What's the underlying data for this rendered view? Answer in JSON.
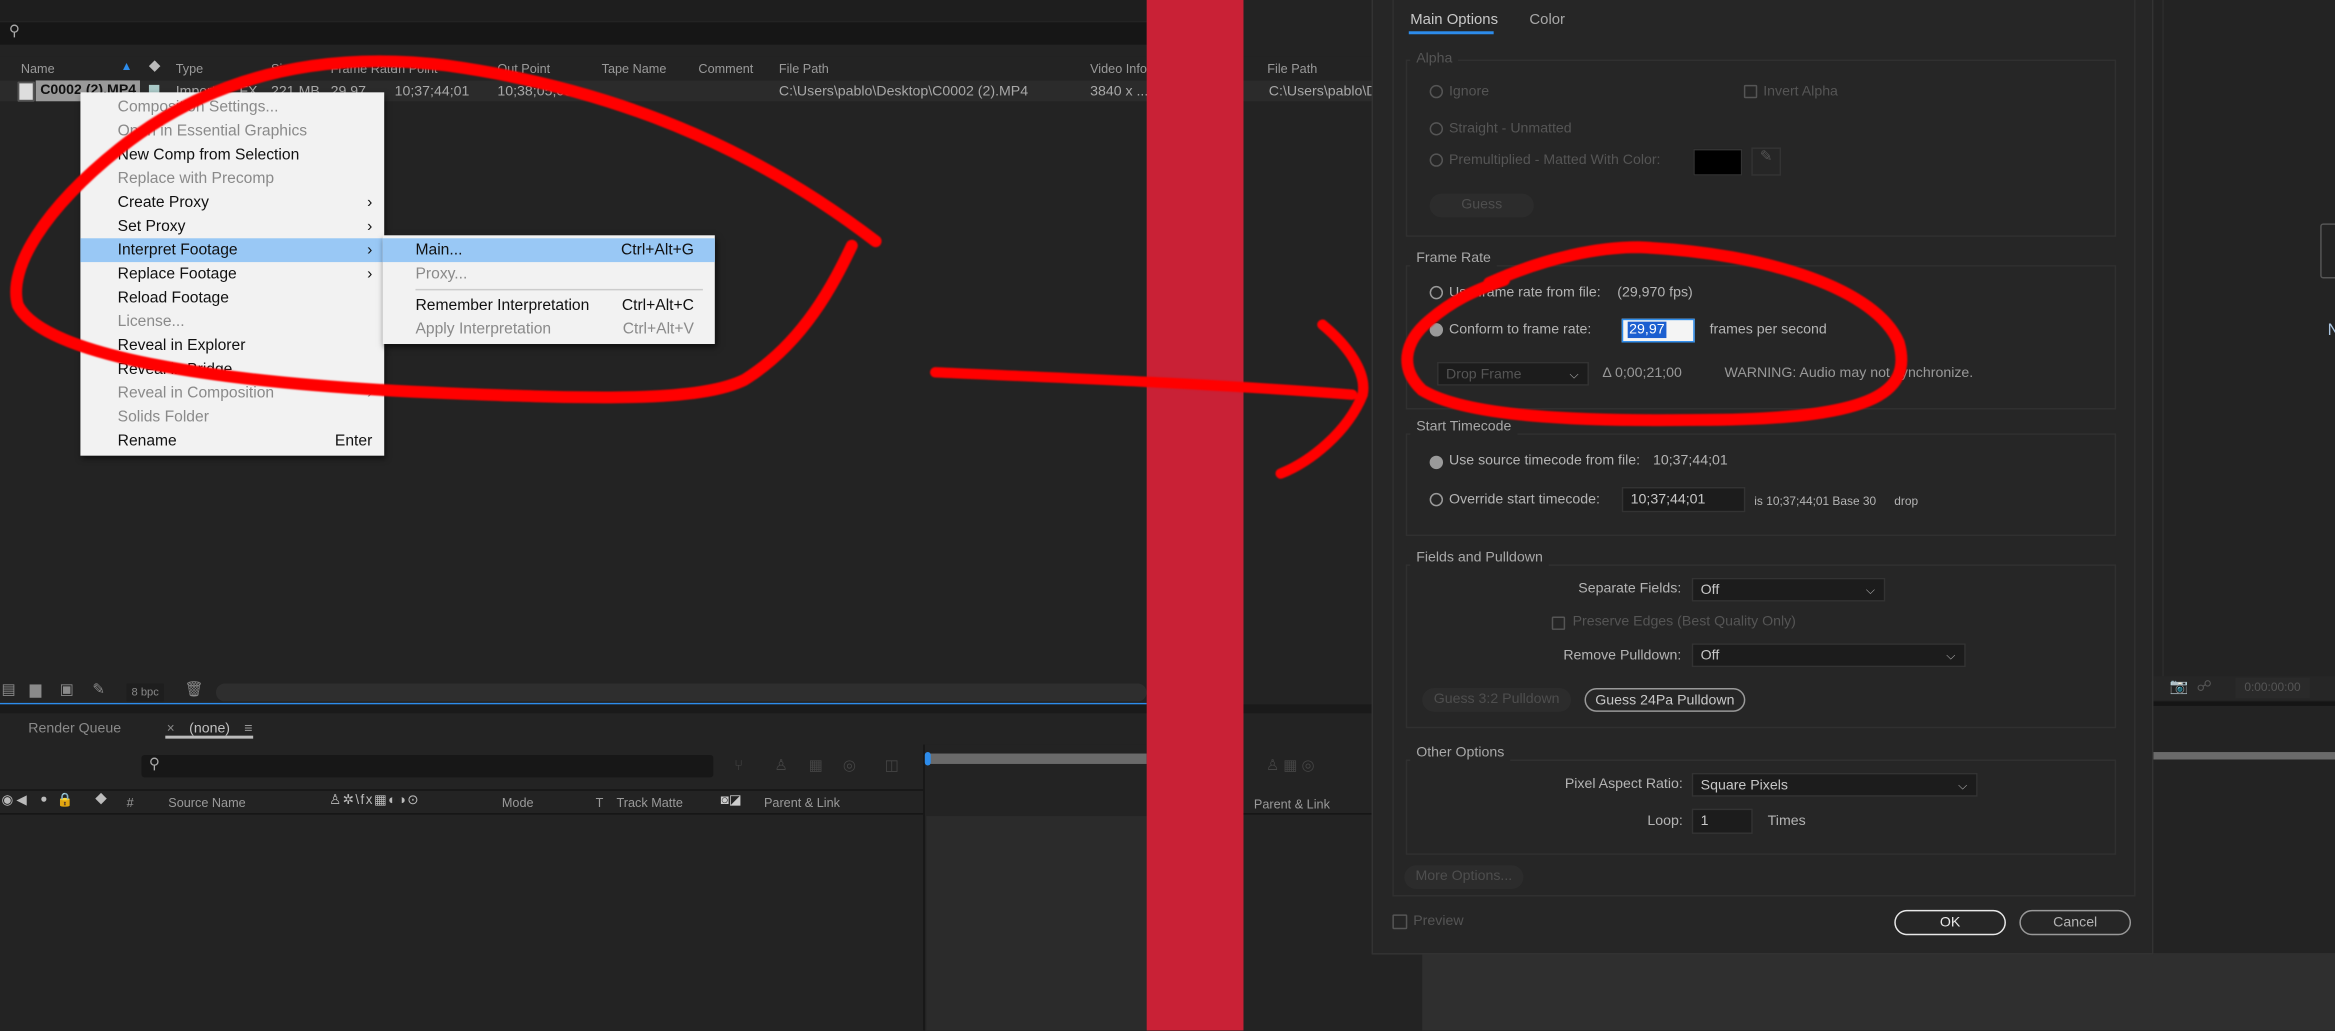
{
  "project_panel": {
    "search_placeholder": "",
    "columns": [
      "Name",
      "Type",
      "Size",
      "Frame Rate",
      "In Point",
      "Out Point",
      "Tape Name",
      "Comment",
      "File Path",
      "Video Info",
      "File Path"
    ],
    "row": {
      "name": "C0002 (2).MP4",
      "type": "Importe... FX",
      "size": "221 MB",
      "frame_rate": "29,97",
      "in_point": "10;37;44;01",
      "out_point": "10;38;05;03",
      "file_path": "C:\\Users\\pablo\\Desktop\\C0002 (2).MP4",
      "video_info": "3840 x ...",
      "file_path_right": "C:\\Users\\pablo\\D"
    },
    "bpc": "8 bpc"
  },
  "context_menu": {
    "items": [
      {
        "label": "Composition Settings...",
        "disabled": true
      },
      {
        "label": "Open in Essential Graphics",
        "disabled": true
      },
      {
        "label": "New Comp from Selection"
      },
      {
        "label": "Replace with Precomp",
        "disabled": true
      },
      {
        "label": "Create Proxy",
        "submenu": true
      },
      {
        "label": "Set Proxy",
        "submenu": true
      },
      {
        "label": "Interpret Footage",
        "submenu": true,
        "highlighted": true
      },
      {
        "label": "Replace Footage",
        "submenu": true
      },
      {
        "label": "Reload Footage"
      },
      {
        "label": "License...",
        "disabled": true
      },
      {
        "label": "Reveal in Explorer"
      },
      {
        "label": "Reveal in Bridge"
      },
      {
        "label": "Reveal in Composition",
        "submenu": true,
        "disabled": true
      },
      {
        "label": "Solids Folder",
        "disabled": true
      },
      {
        "label": "Rename",
        "shortcut": "Enter"
      }
    ],
    "submenu": [
      {
        "label": "Main...",
        "shortcut": "Ctrl+Alt+G",
        "highlighted": true
      },
      {
        "label": "Proxy...",
        "disabled": true
      },
      {
        "label": "Remember Interpretation",
        "shortcut": "Ctrl+Alt+C"
      },
      {
        "label": "Apply Interpretation",
        "shortcut": "Ctrl+Alt+V",
        "disabled": true
      }
    ]
  },
  "timeline": {
    "tabs": [
      "Render Queue",
      "(none)"
    ],
    "close_glyph": "×",
    "menu_glyph": "≡",
    "columns": [
      "#",
      "Source Name",
      "Mode",
      "T",
      "Track Matte",
      "Parent & Link"
    ],
    "right_parent_link": "Parent & Link",
    "viewer_time": "0:00:00:00",
    "viewer_letter": "N"
  },
  "dialog": {
    "tabs": [
      "Main Options",
      "Color"
    ],
    "active_tab": "Main Options",
    "alpha": {
      "title": "Alpha",
      "ignore": "Ignore",
      "invert": "Invert Alpha",
      "straight": "Straight - Unmatted",
      "premultiplied": "Premultiplied - Matted With Color:",
      "matte_color": "#000000",
      "guess": "Guess"
    },
    "frame_rate": {
      "title": "Frame Rate",
      "use_file": "Use frame rate from file:",
      "file_fps": "(29,970 fps)",
      "conform": "Conform to frame rate:",
      "conform_value": "29,97",
      "fps_label": "frames per second",
      "drop_frame": "Drop Frame",
      "delta": "Δ 0;00;21;00",
      "warning": "WARNING: Audio may not synchronize."
    },
    "start_timecode": {
      "title": "Start Timecode",
      "use_source": "Use source timecode from file:",
      "source_value": "10;37;44;01",
      "override": "Override start timecode:",
      "override_value": "10;37;44;01",
      "info": "is 10;37;44;01  Base 30",
      "drop": "drop"
    },
    "fields": {
      "title": "Fields and Pulldown",
      "separate_label": "Separate Fields:",
      "separate_value": "Off",
      "preserve": "Preserve Edges (Best Quality Only)",
      "remove_label": "Remove Pulldown:",
      "remove_value": "Off",
      "guess32": "Guess 3:2 Pulldown",
      "guess24": "Guess 24Pa Pulldown"
    },
    "other": {
      "title": "Other Options",
      "par_label": "Pixel Aspect Ratio:",
      "par_value": "Square Pixels",
      "loop_label": "Loop:",
      "loop_value": "1",
      "times": "Times"
    },
    "more_options": "More Options...",
    "preview": "Preview",
    "ok": "OK",
    "cancel": "Cancel"
  },
  "colors": {
    "accent": "#2d8ceb",
    "menu_highlight": "#99c8f5",
    "divider": "#c92136",
    "annotation": "#ff0000"
  }
}
